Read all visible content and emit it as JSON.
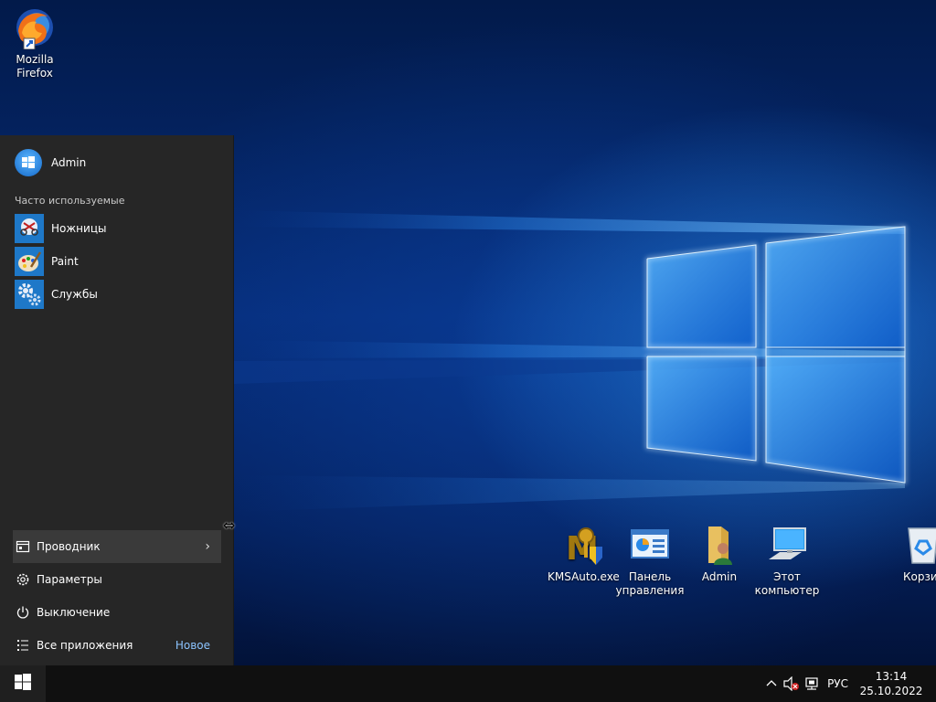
{
  "desktop": {
    "icons": [
      {
        "label": "Mozilla\nFirefox",
        "icon": "firefox-icon"
      },
      {
        "label": "KMSAuto.exe",
        "icon": "kmsauto-icon"
      },
      {
        "label": "Панель управления",
        "icon": "control-panel-icon"
      },
      {
        "label": "Admin",
        "icon": "user-folder-icon"
      },
      {
        "label": "Этот компьютер",
        "icon": "computer-icon"
      },
      {
        "label": "Корзина",
        "icon": "recycle-bin-icon"
      }
    ]
  },
  "start_menu": {
    "user_name": "Admin",
    "section_title": "Часто используемые",
    "apps": [
      {
        "label": "Ножницы",
        "icon": "scissors-icon"
      },
      {
        "label": "Paint",
        "icon": "paint-icon"
      },
      {
        "label": "Службы",
        "icon": "services-gear-icon"
      }
    ],
    "bottom": {
      "explorer": "Проводник",
      "settings": "Параметры",
      "power": "Выключение",
      "all_apps": "Все приложения",
      "new_badge": "Новое"
    }
  },
  "taskbar": {
    "language": "РУС",
    "time": "13:14",
    "date": "25.10.2022"
  },
  "colors": {
    "accent": "#1e78c8",
    "menu_bg": "#262626",
    "taskbar_bg": "#101010",
    "badge": "#8cc4ff"
  }
}
